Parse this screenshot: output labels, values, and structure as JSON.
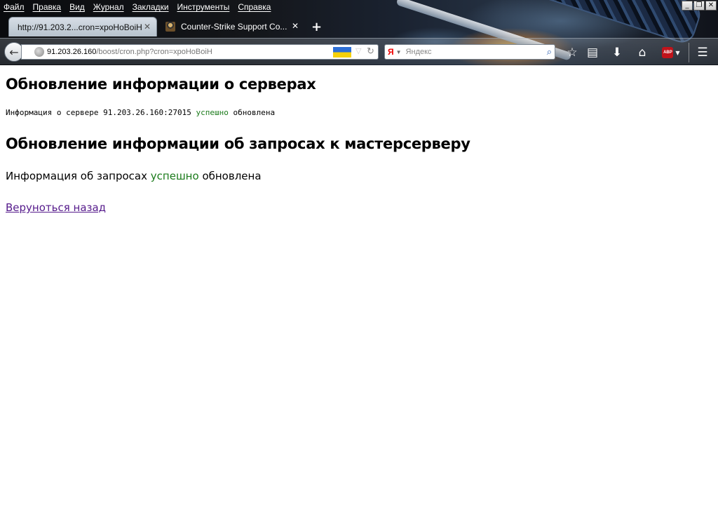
{
  "browser": {
    "menu": [
      "Файл",
      "Правка",
      "Вид",
      "Журнал",
      "Закладки",
      "Инструменты",
      "Справка"
    ],
    "window_controls": [
      "_",
      "❐",
      "✕"
    ],
    "tabs": [
      {
        "title": "http://91.203.2...cron=xpoHoBoiH",
        "close": "✕"
      },
      {
        "title": "Counter-Strike Support Co...",
        "close": "✕"
      }
    ],
    "new_tab": "+",
    "url": {
      "host": "91.203.26.160",
      "path": "/boost/cron.php?cron=xpoHoBoiH"
    },
    "search": {
      "engine_glyph": "Я",
      "placeholder": "Яндекс"
    },
    "icons": [
      "back-arrow-icon",
      "globe-icon",
      "ukraine-flag-icon",
      "dropmarker-icon",
      "reload-icon",
      "yandex-icon",
      "search-icon",
      "bookmark-star-icon",
      "bookmarks-list-icon",
      "download-icon",
      "home-icon",
      "adblock-plus-icon",
      "menu-icon"
    ],
    "toolbar": {
      "abp_label": "ABP"
    }
  },
  "page": {
    "heading_servers": "Обновление информации о серверах",
    "server_info": {
      "prefix": "Информация о сервере 91.203.26.160:27015",
      "status": "успешно",
      "suffix": "обновлена"
    },
    "heading_master": "Обновление информации об запросах к мастерсерверу",
    "master_info": {
      "prefix": "Информация об запросах",
      "status": "успешно",
      "suffix": "обновлена"
    },
    "back_link": "Веруноться назад"
  },
  "colors": {
    "success": "#1a7a1a",
    "visited_link": "#551a8b"
  }
}
